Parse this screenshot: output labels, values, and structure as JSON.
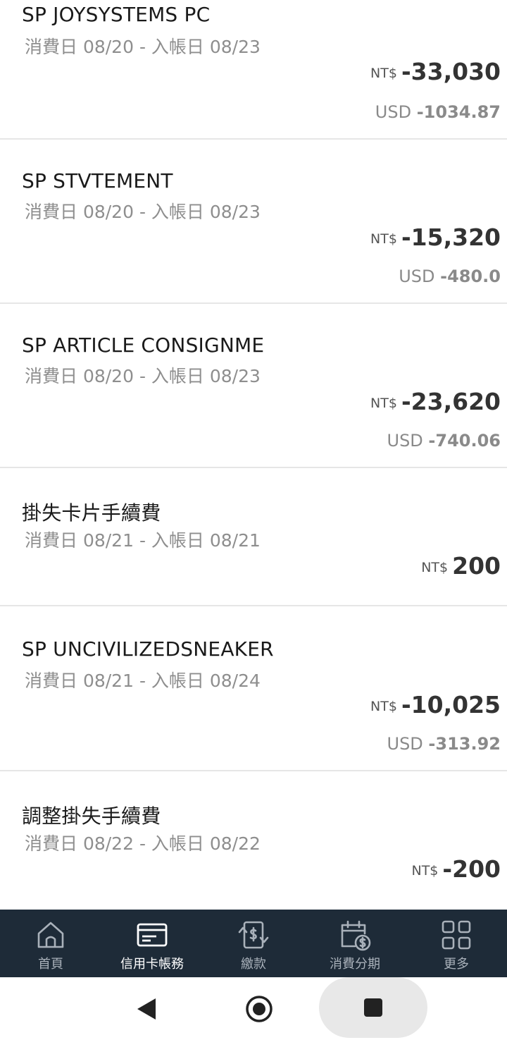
{
  "transactions": [
    {
      "name": "SP JOYSYSTEMS PC",
      "dates": "消費日 08/20 - 入帳日 08/23",
      "currency": "NT$",
      "amount": "-33,030",
      "usd_label": "USD",
      "usd_amount": "-1034.87"
    },
    {
      "name": "SP STVTEMENT",
      "dates": "消費日 08/20 - 入帳日 08/23",
      "currency": "NT$",
      "amount": "-15,320",
      "usd_label": "USD",
      "usd_amount": "-480.0"
    },
    {
      "name": "SP ARTICLE CONSIGNME",
      "dates": "消費日 08/20 - 入帳日 08/23",
      "currency": "NT$",
      "amount": "-23,620",
      "usd_label": "USD",
      "usd_amount": "-740.06"
    },
    {
      "name": "掛失卡片手續費",
      "dates": "消費日 08/21 - 入帳日 08/21",
      "currency": "NT$",
      "amount": "200"
    },
    {
      "name": "SP UNCIVILIZEDSNEAKER",
      "dates": "消費日 08/21 - 入帳日 08/24",
      "currency": "NT$",
      "amount": "-10,025",
      "usd_label": "USD",
      "usd_amount": "-313.92"
    },
    {
      "name": "調整掛失手續費",
      "dates": "消費日 08/22 - 入帳日 08/22",
      "currency": "NT$",
      "amount": "-200"
    }
  ],
  "tabbar": {
    "items": [
      {
        "label": "首頁",
        "icon": "home-icon",
        "active": false
      },
      {
        "label": "信用卡帳務",
        "icon": "credit-card-icon",
        "active": true
      },
      {
        "label": "繳款",
        "icon": "payment-icon",
        "active": false
      },
      {
        "label": "消費分期",
        "icon": "installment-calendar-icon",
        "active": false
      },
      {
        "label": "更多",
        "icon": "grid-more-icon",
        "active": false
      }
    ]
  },
  "colors": {
    "tabbar_bg": "#1e2b38",
    "tab_active": "#ffffff",
    "tab_inactive": "#a9b1ba",
    "amount": "#333333",
    "muted": "#8e8e8e"
  }
}
